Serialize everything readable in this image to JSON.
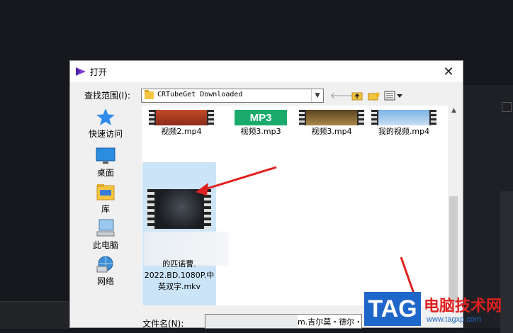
{
  "dialog": {
    "title": "打开",
    "close": "✕"
  },
  "lookin": {
    "label": "查找范围(I):",
    "value": "CRTubeGet Downloaded"
  },
  "places": [
    {
      "label": "快速访问",
      "icon": "star-icon"
    },
    {
      "label": "桌面",
      "icon": "desktop-icon"
    },
    {
      "label": "库",
      "icon": "library-icon"
    },
    {
      "label": "此电脑",
      "icon": "computer-icon"
    },
    {
      "label": "网络",
      "icon": "network-icon"
    }
  ],
  "files": [
    {
      "name": "视频2.mp4",
      "kind": "video"
    },
    {
      "name": "视频3.mp3",
      "kind": "audio",
      "badge": "MP3"
    },
    {
      "name": "视频3.mp4",
      "kind": "video"
    },
    {
      "name": "我的视频.mp4",
      "kind": "video"
    }
  ],
  "selected_file": {
    "name_lines": [
      "的匹诺曹.",
      "2022.BD.1080P.中",
      "英双字.mkv"
    ]
  },
  "filename": {
    "label": "文件名(N):",
    "value": "m.吉尔莫・德尔・"
  },
  "watermark": {
    "tag": "TAG",
    "site_name": "电脑技术网",
    "url": "www.tagxp.com"
  },
  "colors": {
    "accent": "#1f66c9",
    "arrow": "#e02020",
    "selection": "#cce4f7"
  }
}
